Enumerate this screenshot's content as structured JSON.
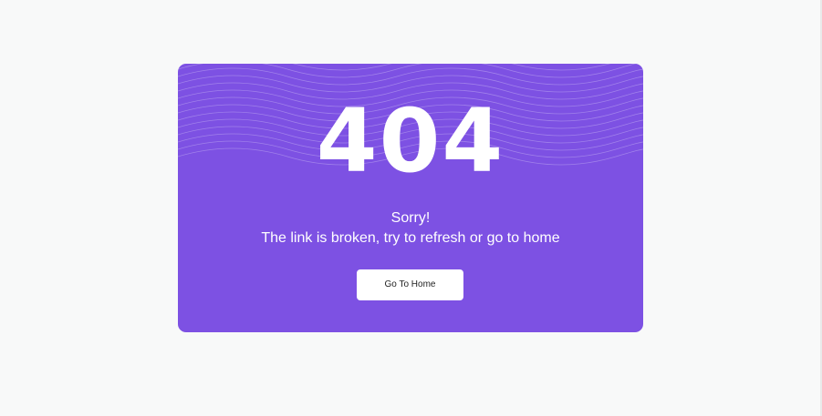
{
  "error": {
    "code": "404",
    "title": "Sorry!",
    "message": "The link is broken, try to refresh or go to home"
  },
  "actions": {
    "home_label": "Go To Home"
  },
  "colors": {
    "background": "#f8f9f9",
    "card": "#7d51e3",
    "text": "#ffffff",
    "button_background": "#ffffff",
    "button_text": "#222222"
  }
}
